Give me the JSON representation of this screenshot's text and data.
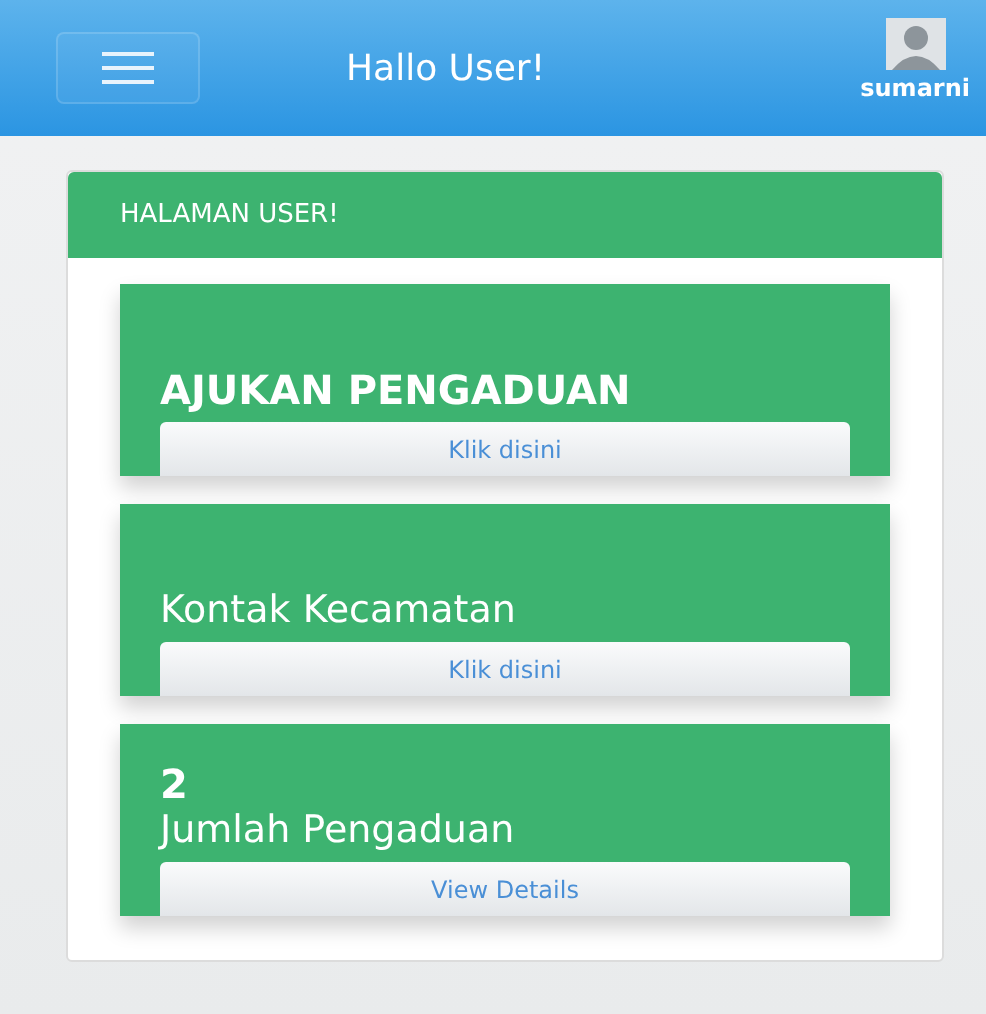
{
  "header": {
    "title": "Hallo User!",
    "username": "sumarni"
  },
  "panel": {
    "heading": "HALAMAN USER!"
  },
  "cards": [
    {
      "kind": "headline",
      "title": "AJUKAN PENGADUAN",
      "button": "Klik disini"
    },
    {
      "kind": "label",
      "title": "Kontak Kecamatan",
      "button": "Klik disini"
    },
    {
      "kind": "stat",
      "count": "2",
      "title": "Jumlah Pengaduan",
      "button": "View Details"
    }
  ]
}
